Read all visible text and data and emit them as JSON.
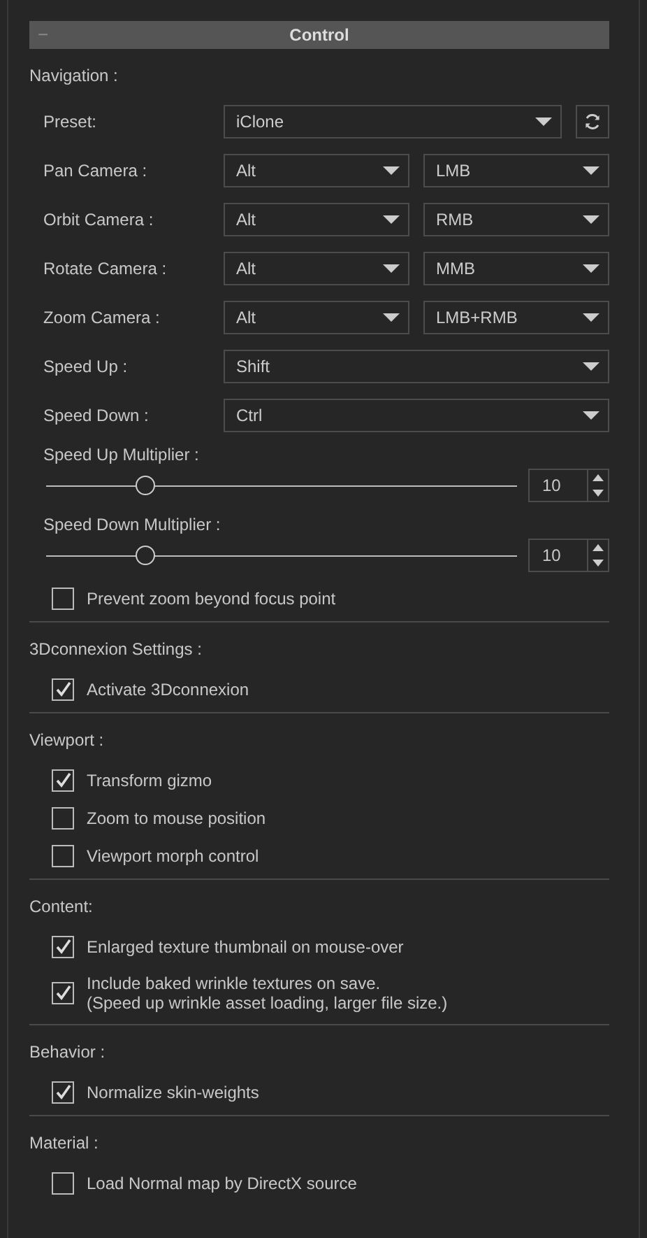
{
  "panel": {
    "title": "Control",
    "toggle": "−",
    "expanded": true
  },
  "sections": [
    {
      "heading": "Navigation :",
      "items": [
        {
          "kind": "preset",
          "label": "Preset:",
          "value": "iClone"
        },
        {
          "kind": "pair",
          "label": "Pan Camera :",
          "values": [
            "Alt",
            "LMB"
          ]
        },
        {
          "kind": "pair",
          "label": "Orbit Camera :",
          "values": [
            "Alt",
            "RMB"
          ]
        },
        {
          "kind": "pair",
          "label": "Rotate Camera :",
          "values": [
            "Alt",
            "MMB"
          ]
        },
        {
          "kind": "pair",
          "label": "Zoom Camera :",
          "values": [
            "Alt",
            "LMB+RMB"
          ]
        },
        {
          "kind": "select",
          "label": "Speed Up :",
          "value": "Shift"
        },
        {
          "kind": "select",
          "label": "Speed Down :",
          "value": "Ctrl"
        },
        {
          "kind": "slider",
          "label": "Speed Up Multiplier :",
          "level": 0.21,
          "value": "10"
        },
        {
          "kind": "slider",
          "label": "Speed Down Multiplier :",
          "level": 0.21,
          "value": "10"
        },
        {
          "kind": "checkbox",
          "label": "Prevent zoom beyond focus point",
          "checked": false
        }
      ]
    },
    {
      "heading": "3Dconnexion Settings :",
      "items": [
        {
          "kind": "checkbox",
          "label": "Activate 3Dconnexion",
          "checked": true
        }
      ]
    },
    {
      "heading": "Viewport :",
      "items": [
        {
          "kind": "checkbox",
          "label": "Transform gizmo",
          "checked": true
        },
        {
          "kind": "checkbox",
          "label": "Zoom to mouse position",
          "checked": false
        },
        {
          "kind": "checkbox",
          "label": "Viewport morph control",
          "checked": false
        }
      ]
    },
    {
      "heading": "Content:",
      "items": [
        {
          "kind": "checkbox",
          "label": "Enlarged texture thumbnail on mouse-over",
          "checked": true
        },
        {
          "kind": "checkbox",
          "label": "Include baked wrinkle textures on save.\n(Speed up wrinkle asset loading, larger file size.)",
          "checked": true
        }
      ]
    },
    {
      "heading": "Behavior :",
      "items": [
        {
          "kind": "checkbox",
          "label": "Normalize skin-weights",
          "checked": true
        }
      ]
    },
    {
      "heading": "Material :",
      "items": [
        {
          "kind": "checkbox",
          "label": "Load Normal map by DirectX source",
          "checked": false
        }
      ]
    }
  ]
}
